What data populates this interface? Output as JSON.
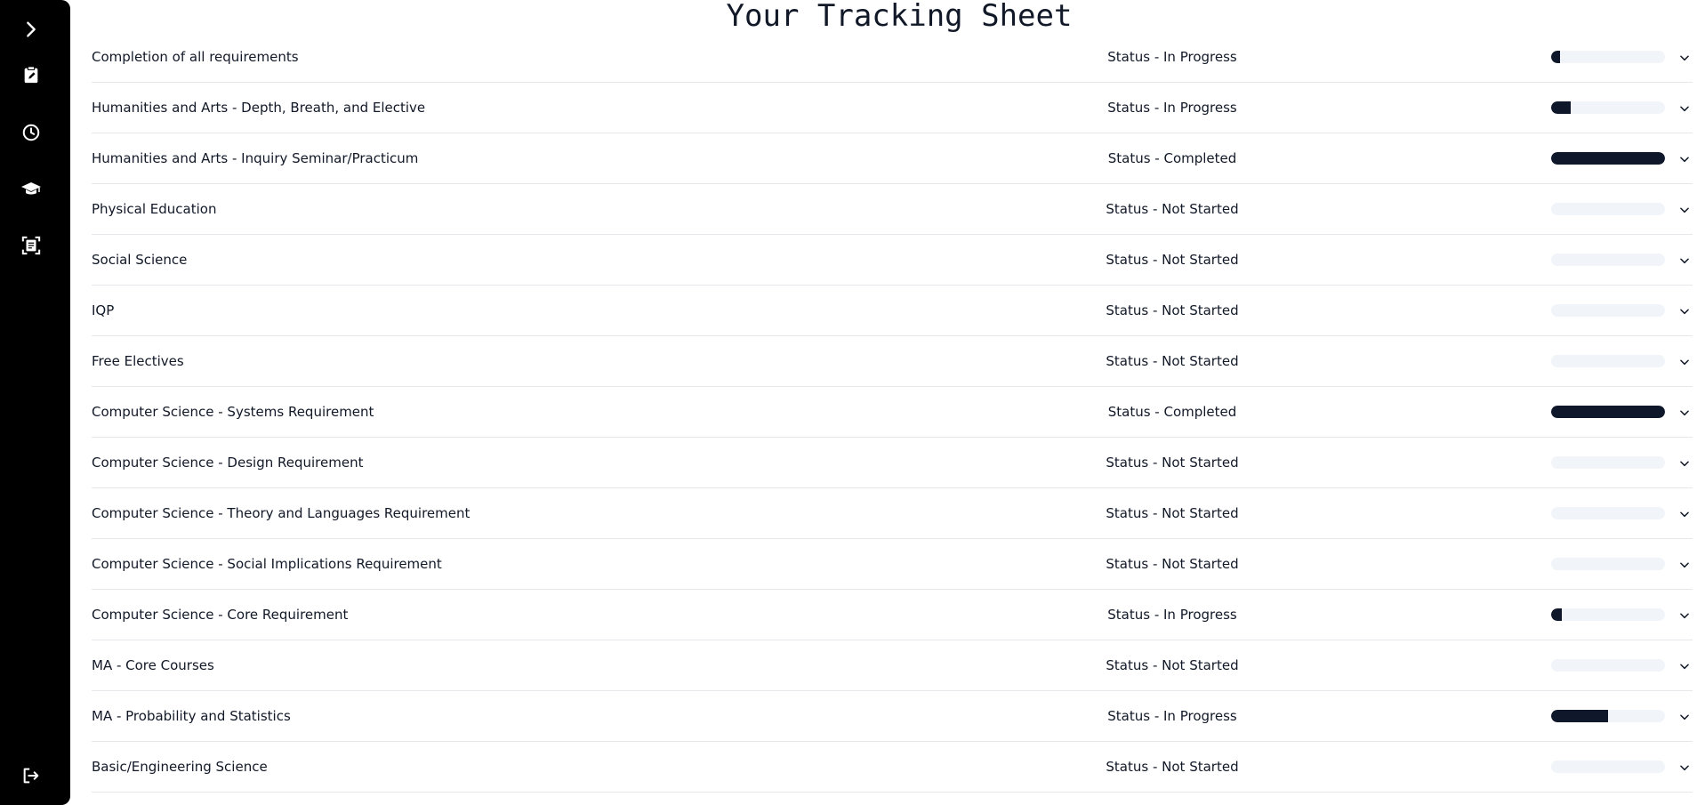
{
  "page": {
    "title": "Your Tracking Sheet"
  },
  "sidebar": {
    "icons": [
      "chevron-right-icon",
      "clipboard-edit-icon",
      "clock-icon",
      "graduation-cap-icon",
      "document-scan-icon",
      "logout-icon"
    ]
  },
  "requirements": [
    {
      "label": "Completion of all requirements",
      "status": "Status - In Progress",
      "progress": 0.08
    },
    {
      "label": "Humanities and Arts - Depth, Breath, and Elective",
      "status": "Status - In Progress",
      "progress": 0.17
    },
    {
      "label": "Humanities and Arts - Inquiry Seminar/Practicum",
      "status": "Status - Completed",
      "progress": 1.0
    },
    {
      "label": "Physical Education",
      "status": "Status - Not Started",
      "progress": 0
    },
    {
      "label": "Social Science",
      "status": "Status - Not Started",
      "progress": 0
    },
    {
      "label": "IQP",
      "status": "Status - Not Started",
      "progress": 0
    },
    {
      "label": "Free Electives",
      "status": "Status - Not Started",
      "progress": 0
    },
    {
      "label": "Computer Science - Systems Requirement",
      "status": "Status - Completed",
      "progress": 1.0
    },
    {
      "label": "Computer Science - Design Requirement",
      "status": "Status - Not Started",
      "progress": 0
    },
    {
      "label": "Computer Science - Theory and Languages Requirement",
      "status": "Status - Not Started",
      "progress": 0
    },
    {
      "label": "Computer Science - Social Implications Requirement",
      "status": "Status - Not Started",
      "progress": 0
    },
    {
      "label": "Computer Science - Core Requirement",
      "status": "Status - In Progress",
      "progress": 0.09
    },
    {
      "label": "MA - Core Courses",
      "status": "Status - Not Started",
      "progress": 0
    },
    {
      "label": "MA - Probability and Statistics",
      "status": "Status - In Progress",
      "progress": 0.5
    },
    {
      "label": "Basic/Engineering Science",
      "status": "Status - Not Started",
      "progress": 0
    }
  ],
  "colors": {
    "sidebar_bg": "#000000",
    "bar_fill": "#0f172a",
    "bar_track": "#f1f5f9",
    "divider": "#e5e7eb"
  }
}
